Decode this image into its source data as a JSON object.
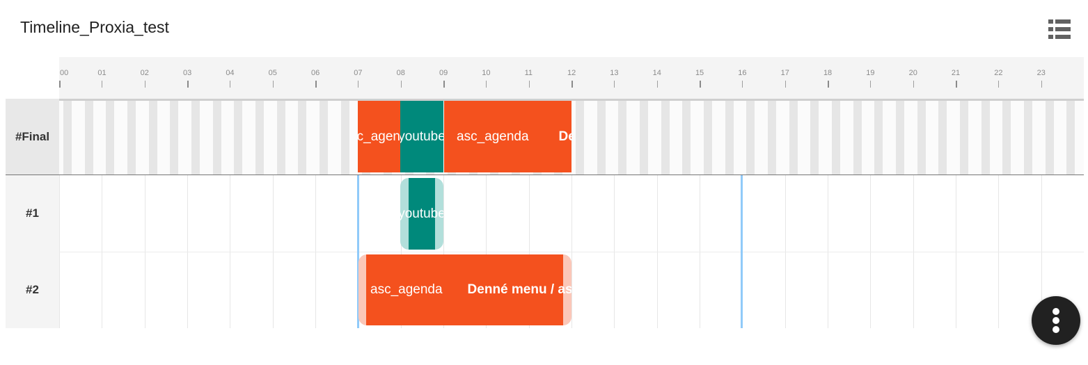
{
  "header": {
    "title": "Timeline_Proxia_test",
    "view_toggle_icon": "list-view-icon"
  },
  "axis": {
    "hours": [
      "00",
      "01",
      "02",
      "03",
      "04",
      "05",
      "06",
      "07",
      "08",
      "09",
      "10",
      "11",
      "12",
      "13",
      "14",
      "15",
      "16",
      "17",
      "18",
      "19",
      "20",
      "21",
      "22",
      "23"
    ]
  },
  "rows": {
    "final": "#Final",
    "row1": "#1",
    "row2": "#2"
  },
  "final_track": {
    "block_1": "c_agen",
    "block_2": "youtube",
    "block_3a": "asc_agenda",
    "block_3b": "De"
  },
  "row1_blocks": {
    "block_1": "youtube"
  },
  "row2_blocks": {
    "block_1a": "asc_agenda",
    "block_1b": "Denné menu / as"
  },
  "colors": {
    "orange": "#f4511e",
    "teal": "#00897b",
    "marker": "#90caf9"
  },
  "fab": {
    "icon": "more-vert-icon"
  }
}
